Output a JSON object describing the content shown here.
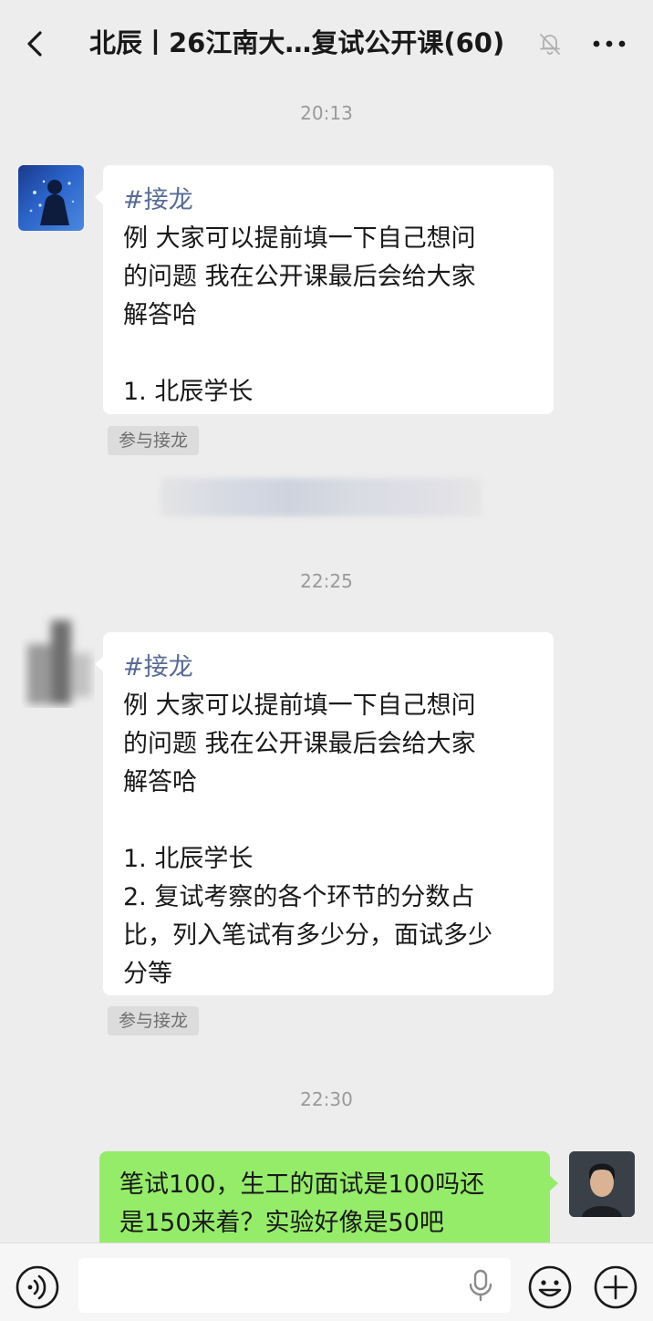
{
  "header": {
    "title": "北辰丨26江南大…复试公开课(60)",
    "back_icon": "chevron-left-icon",
    "mute_icon": "bell-off-icon",
    "more_icon": "ellipsis-icon"
  },
  "messages": [
    {
      "time": "20:13",
      "tag": "#接龙",
      "lines": [
        "例 大家可以提前填一下自己想问",
        "的问题 我在公开课最后会给大家",
        "解答哈"
      ],
      "entries": [
        "1. 北辰学长"
      ],
      "join_label": "参与接龙"
    },
    {
      "time": "22:25",
      "tag": "#接龙",
      "lines": [
        "例 大家可以提前填一下自己想问",
        "的问题 我在公开课最后会给大家",
        "解答哈"
      ],
      "entries": [
        "1. 北辰学长",
        "2. 复试考察的各个环节的分数占",
        "比，列入笔试有多少分，面试多少",
        "分等"
      ],
      "join_label": "参与接龙"
    },
    {
      "time": "22:30",
      "lines": [
        "笔试100，生工的面试是100吗还",
        "是150来着？实验好像是50吧"
      ]
    }
  ],
  "input_bar": {
    "voice_icon": "voice-icon",
    "mic_icon": "microphone-icon",
    "emoji_icon": "emoji-icon",
    "plus_icon": "plus-icon"
  },
  "colors": {
    "background": "#ededed",
    "bubble_in": "#ffffff",
    "bubble_out": "#95ec69",
    "tag_link": "#576b95",
    "timestamp": "#9a9a9a"
  }
}
